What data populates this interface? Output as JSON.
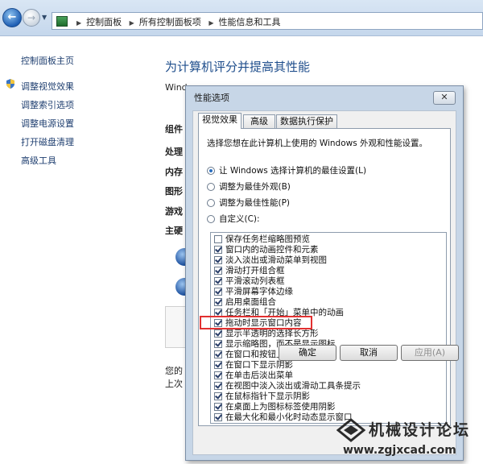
{
  "address_bar": {
    "breadcrumbs": [
      "控制面板",
      "所有控制面板项",
      "性能信息和工具"
    ]
  },
  "left_pane": {
    "home_link": "控制面板主页",
    "links": [
      "调整视觉效果",
      "调整索引选项",
      "调整电源设置",
      "打开磁盘清理",
      "高级工具"
    ]
  },
  "main": {
    "title": "为计算机评分并提高其性能",
    "background_fragments": {
      "windows": "Wind",
      "component": "组件",
      "processor": "处理",
      "memory": "内存",
      "graphics": "图形",
      "gaming": "游戏",
      "primary_disk": "主硬",
      "your_prefix": "您的",
      "last_prefix": "上次"
    }
  },
  "dialog": {
    "title": "性能选项",
    "close_glyph": "✕",
    "tabs": [
      "视觉效果",
      "高级",
      "数据执行保护"
    ],
    "description": "选择您想在此计算机上使用的 Windows 外观和性能设置。",
    "radios": [
      {
        "label": "让 Windows 选择计算机的最佳设置(L)",
        "selected": true
      },
      {
        "label": "调整为最佳外观(B)",
        "selected": false
      },
      {
        "label": "调整为最佳性能(P)",
        "selected": false
      },
      {
        "label": "自定义(C):",
        "selected": false
      }
    ],
    "options": [
      {
        "label": "保存任务栏缩略图预览",
        "checked": false
      },
      {
        "label": "窗口内的动画控件和元素",
        "checked": true
      },
      {
        "label": "淡入淡出或滑动菜单到视图",
        "checked": true
      },
      {
        "label": "滑动打开组合框",
        "checked": true
      },
      {
        "label": "平滑滚动列表框",
        "checked": true
      },
      {
        "label": "平滑屏幕字体边缘",
        "checked": true
      },
      {
        "label": "启用桌面组合",
        "checked": true
      },
      {
        "label": "任务栏和「开始」菜单中的动画",
        "checked": true
      },
      {
        "label": "拖动时显示窗口内容",
        "checked": true
      },
      {
        "label": "显示半透明的选择长方形",
        "checked": true
      },
      {
        "label": "显示缩略图，而不是显示图标",
        "checked": true
      },
      {
        "label": "在窗口和按钮上使用视觉样式",
        "checked": true
      },
      {
        "label": "在窗口下显示阴影",
        "checked": true
      },
      {
        "label": "在单击后淡出菜单",
        "checked": true
      },
      {
        "label": "在视图中淡入淡出或滑动工具条提示",
        "checked": true
      },
      {
        "label": "在鼠标指针下显示阴影",
        "checked": true
      },
      {
        "label": "在桌面上为图标标签使用阴影",
        "checked": true
      },
      {
        "label": "在最大化和最小化时动态显示窗口",
        "checked": true
      }
    ],
    "buttons": {
      "ok": "确定",
      "cancel": "取消",
      "apply": "应用(A)"
    }
  },
  "watermark": {
    "name": "机械设计论坛",
    "url": "www.zgjxcad.com"
  },
  "colors": {
    "link": "#1f3f70",
    "title": "#1f4e8c",
    "highlight": "#e23030"
  }
}
